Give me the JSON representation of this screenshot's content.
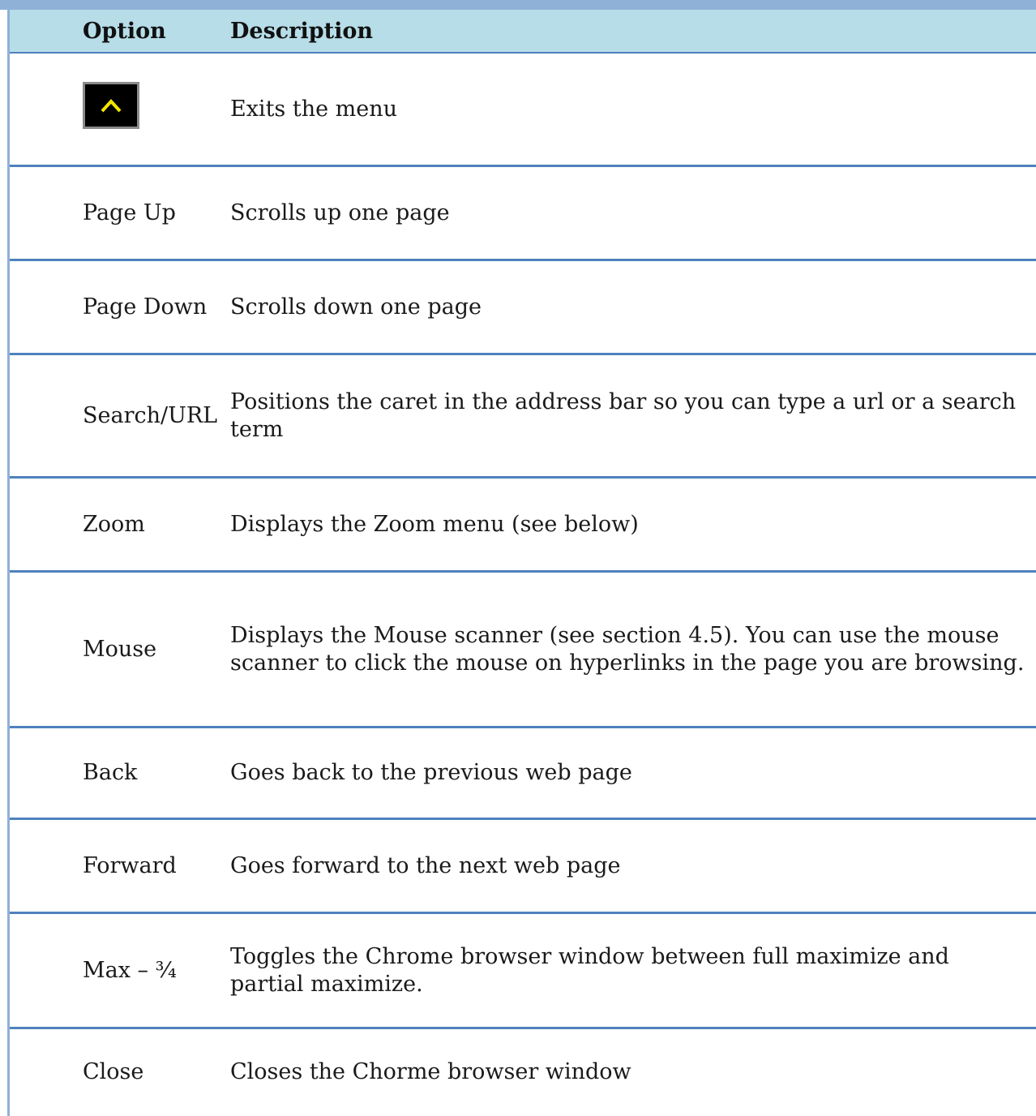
{
  "header": {
    "option": "Option",
    "description": "Description"
  },
  "rows": [
    {
      "option": "",
      "icon": "chevron-up-icon",
      "icon_color": "#f2e600",
      "description": "Exits the menu"
    },
    {
      "option": "Page Up",
      "description": "Scrolls up one page"
    },
    {
      "option": "Page Down",
      "description": "Scrolls down one page"
    },
    {
      "option": "Search/URL",
      "description": "Positions the caret in the address bar so you can type a url or a search term"
    },
    {
      "option": "Zoom",
      "description": "Displays the Zoom menu (see below)"
    },
    {
      "option": "Mouse",
      "description": "Displays the Mouse scanner (see section 4.5).  You can use the mouse scanner to click the mouse on hyperlinks in the page you are browsing."
    },
    {
      "option": "Back",
      "description": "Goes back to the previous web page"
    },
    {
      "option": "Forward",
      "description": "Goes forward to the next web page"
    },
    {
      "option": "Max – ¾",
      "description": "Toggles the Chrome browser window between full maximize and partial maximize."
    },
    {
      "option": "Close",
      "description": "Closes the Chorme browser window"
    }
  ],
  "colors": {
    "header_bg": "#b6dde8",
    "rule": "#4f81bd",
    "frame": "#8fb1d8"
  }
}
